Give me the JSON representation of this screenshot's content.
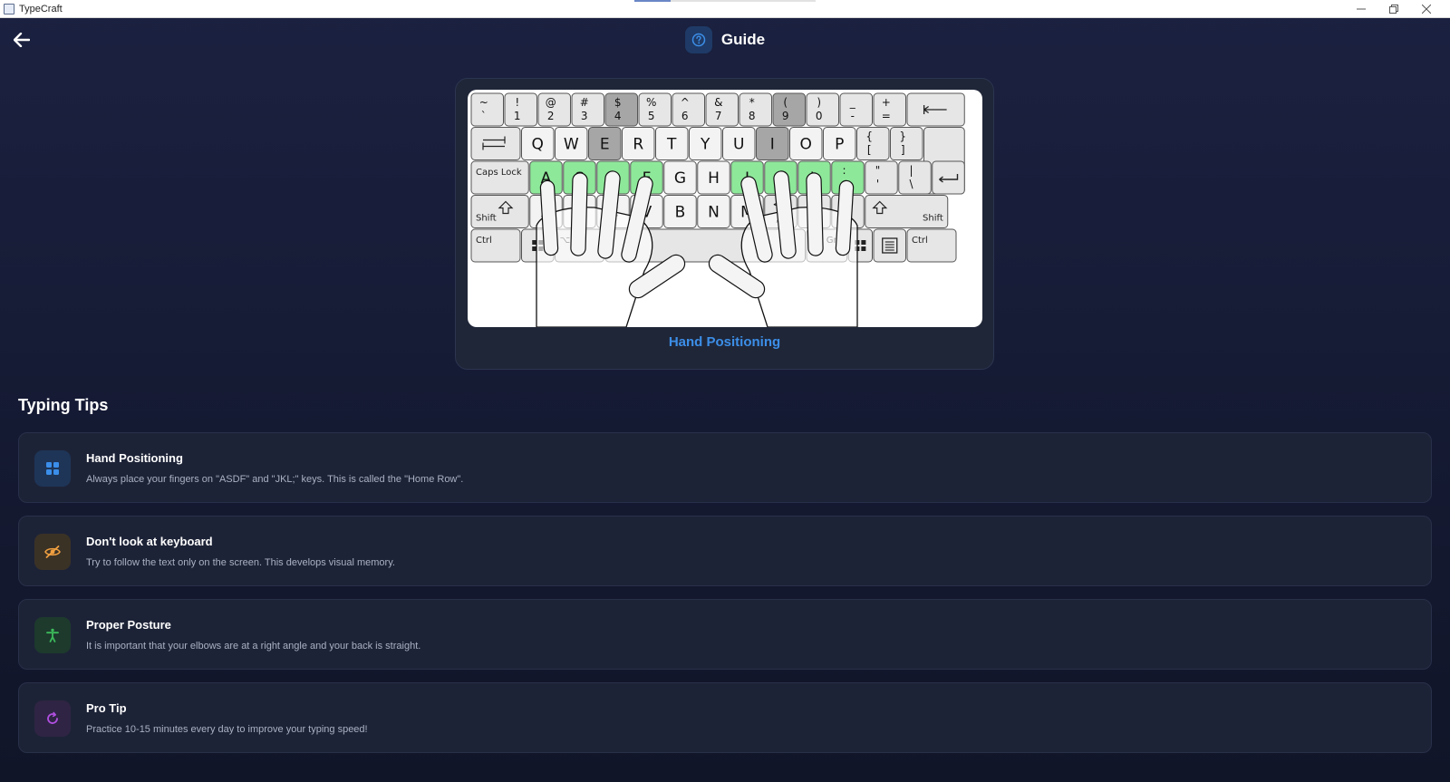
{
  "window": {
    "app_title": "TypeCraft",
    "controls": [
      "minimize",
      "restore",
      "close"
    ],
    "loading_progress": 0.2
  },
  "header": {
    "title": "Guide",
    "back_icon": "arrow-left-icon",
    "help_icon": "question-circle-icon"
  },
  "keyboard": {
    "caption": "Hand Positioning",
    "home_row_color": "#8ee89a",
    "highlight_color": "#a6a6a6",
    "rows": [
      [
        {
          "u": "~",
          "l": "`",
          "w": 1
        },
        {
          "u": "!",
          "l": "1",
          "w": 1
        },
        {
          "u": "@",
          "l": "2",
          "w": 1
        },
        {
          "u": "#",
          "l": "3",
          "w": 1
        },
        {
          "u": "$",
          "l": "4",
          "w": 1,
          "hl": true
        },
        {
          "u": "%",
          "l": "5",
          "w": 1
        },
        {
          "u": "^",
          "l": "6",
          "w": 1
        },
        {
          "u": "&",
          "l": "7",
          "w": 1
        },
        {
          "u": "*",
          "l": "8",
          "w": 1
        },
        {
          "u": "(",
          "l": "9",
          "w": 1,
          "hl": true
        },
        {
          "u": ")",
          "l": "0",
          "w": 1
        },
        {
          "u": "_",
          "l": "-",
          "w": 1
        },
        {
          "u": "+",
          "l": "=",
          "w": 1
        },
        {
          "icon": "backspace-icon",
          "w": 1.75
        }
      ],
      [
        {
          "icon": "tab-icon",
          "w": 1.5
        },
        {
          "c": "Q",
          "w": 1
        },
        {
          "c": "W",
          "w": 1
        },
        {
          "c": "E",
          "w": 1,
          "hl": true
        },
        {
          "c": "R",
          "w": 1
        },
        {
          "c": "T",
          "w": 1
        },
        {
          "c": "Y",
          "w": 1
        },
        {
          "c": "U",
          "w": 1
        },
        {
          "c": "I",
          "w": 1,
          "hl": true
        },
        {
          "c": "O",
          "w": 1
        },
        {
          "c": "P",
          "w": 1
        },
        {
          "u": "{",
          "l": "[",
          "w": 1
        },
        {
          "u": "}",
          "l": "]",
          "w": 1
        },
        {
          "c": "",
          "w": 1.25,
          "tall": true
        }
      ],
      [
        {
          "t": "Caps Lock",
          "w": 1.75
        },
        {
          "c": "A",
          "w": 1,
          "home": true
        },
        {
          "c": "S",
          "w": 1,
          "home": true
        },
        {
          "c": "D",
          "w": 1,
          "home": true
        },
        {
          "c": "F",
          "w": 1,
          "home": true
        },
        {
          "c": "G",
          "w": 1
        },
        {
          "c": "H",
          "w": 1
        },
        {
          "c": "J",
          "w": 1,
          "home": true
        },
        {
          "c": "K",
          "w": 1,
          "home": true
        },
        {
          "c": "L",
          "w": 1,
          "home": true
        },
        {
          "u": ":",
          "l": ";",
          "w": 1,
          "home": true
        },
        {
          "u": "\"",
          "l": "'",
          "w": 1
        },
        {
          "u": "|",
          "l": "\\",
          "w": 1
        },
        {
          "icon": "enter-icon",
          "w": 1
        }
      ],
      [
        {
          "t": "Shift",
          "icon": "shift-icon",
          "w": 1.75
        },
        {
          "c": "Z",
          "w": 1
        },
        {
          "c": "X",
          "w": 1
        },
        {
          "c": "C",
          "w": 1
        },
        {
          "c": "V",
          "w": 1
        },
        {
          "c": "B",
          "w": 1
        },
        {
          "c": "N",
          "w": 1
        },
        {
          "c": "M",
          "w": 1
        },
        {
          "u": "<",
          "l": ",",
          "w": 1
        },
        {
          "u": ">",
          "l": ".",
          "w": 1
        },
        {
          "u": "?",
          "l": "/",
          "w": 1
        },
        {
          "icon": "shift-icon",
          "t": "Shift",
          "w": 2.5,
          "rt": true
        }
      ],
      [
        {
          "t": "Ctrl",
          "w": 1.5
        },
        {
          "icon": "windows-icon",
          "w": 1
        },
        {
          "t": "⌥ Alt",
          "w": 1.5
        },
        {
          "c": "",
          "w": 6
        },
        {
          "t": "Alt Gr",
          "w": 1.25
        },
        {
          "icon": "windows-icon",
          "w": 0.75
        },
        {
          "icon": "menu-icon",
          "w": 1
        },
        {
          "t": "Ctrl",
          "w": 1.5
        }
      ]
    ]
  },
  "tips": {
    "section_title": "Typing Tips",
    "items": [
      {
        "title": "Hand Positioning",
        "description": "Always place your fingers on \"ASDF\" and \"JKL;\" keys. This is called the \"Home Row\".",
        "icon": "grid-icon",
        "icon_color": "#3b8eea",
        "icon_bg": "#1e3557"
      },
      {
        "title": "Don't look at keyboard",
        "description": "Try to follow the text only on the screen. This develops visual memory.",
        "icon": "eye-off-icon",
        "icon_color": "#f0a040",
        "icon_bg": "#3b3226"
      },
      {
        "title": "Proper Posture",
        "description": "It is important that your elbows are at a right angle and your back is straight.",
        "icon": "accessibility-icon",
        "icon_color": "#3dbb5b",
        "icon_bg": "#1d3a2d"
      },
      {
        "title": "Pro Tip",
        "description": "Practice 10-15 minutes every day to improve your typing speed!",
        "icon": "refresh-icon",
        "icon_color": "#b04fe0",
        "icon_bg": "#2f2444"
      }
    ]
  }
}
